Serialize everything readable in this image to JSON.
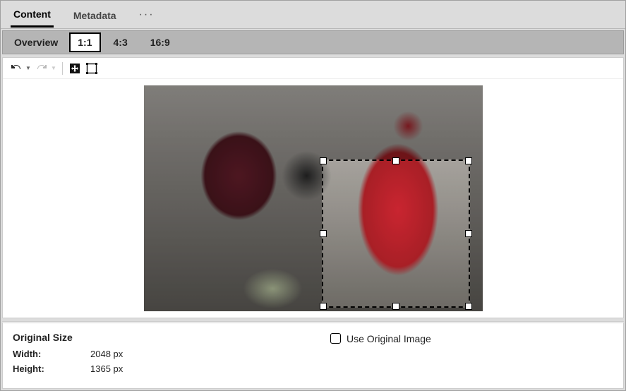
{
  "tabs": {
    "content": "Content",
    "metadata": "Metadata",
    "more": "···"
  },
  "ratios": {
    "overview": "Overview",
    "r1_1": "1:1",
    "r4_3": "4:3",
    "r16_9": "16:9"
  },
  "toolbar": {
    "undo": "undo-icon",
    "redo": "redo-icon",
    "move": "move-icon",
    "crop": "crop-frame-icon"
  },
  "original": {
    "title": "Original Size",
    "width_label": "Width:",
    "width_value": "2048 px",
    "height_label": "Height:",
    "height_value": "1365 px"
  },
  "use_original_label": "Use Original Image"
}
